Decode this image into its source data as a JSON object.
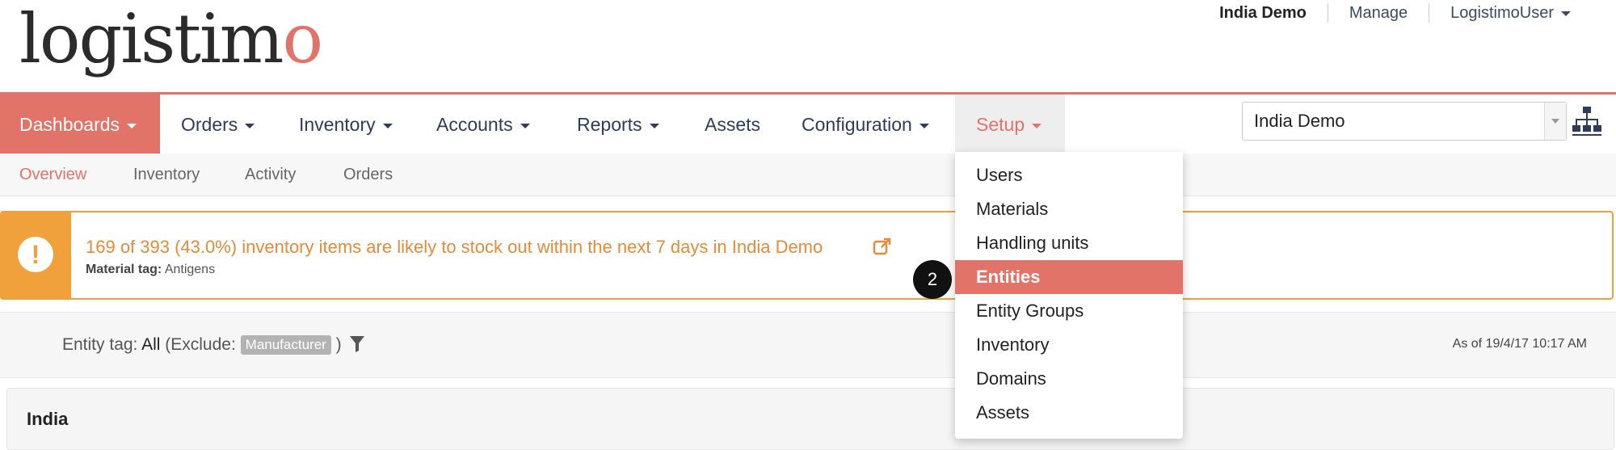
{
  "header": {
    "logo_prefix": "logistim",
    "logo_suffix": "o",
    "links": [
      {
        "label": "India Demo"
      },
      {
        "label": "Manage"
      },
      {
        "label": "LogistimoUser"
      }
    ]
  },
  "nav": {
    "items": [
      {
        "label": "Dashboards"
      },
      {
        "label": "Orders"
      },
      {
        "label": "Inventory"
      },
      {
        "label": "Accounts"
      },
      {
        "label": "Reports"
      },
      {
        "label": "Assets"
      },
      {
        "label": "Configuration"
      },
      {
        "label": "Setup"
      }
    ],
    "domain_select": "India Demo"
  },
  "subnav": {
    "items": [
      {
        "label": "Overview"
      },
      {
        "label": "Inventory"
      },
      {
        "label": "Activity"
      },
      {
        "label": "Orders"
      }
    ]
  },
  "alert": {
    "message": "169 of 393 (43.0%) inventory items are likely to stock out within the next 7 days in India Demo",
    "tag_label": "Material tag:",
    "tag_value": "Antigens"
  },
  "filter": {
    "prefix": "Entity tag:",
    "value": "All",
    "exclude_label": "(Exclude:",
    "exclude_badge": "Manufacturer",
    "close": ")",
    "as_of": "As of 19/4/17 10:17 AM"
  },
  "panel": {
    "title": "India"
  },
  "setup_menu": {
    "items": [
      {
        "label": "Users"
      },
      {
        "label": "Materials"
      },
      {
        "label": "Handling units"
      },
      {
        "label": "Entities"
      },
      {
        "label": "Entity Groups"
      },
      {
        "label": "Inventory"
      },
      {
        "label": "Domains"
      },
      {
        "label": "Assets"
      }
    ],
    "step": "2"
  },
  "colors": {
    "accent": "#e27368",
    "warning": "#f0a13b",
    "nav_text": "#2e3c5a"
  }
}
